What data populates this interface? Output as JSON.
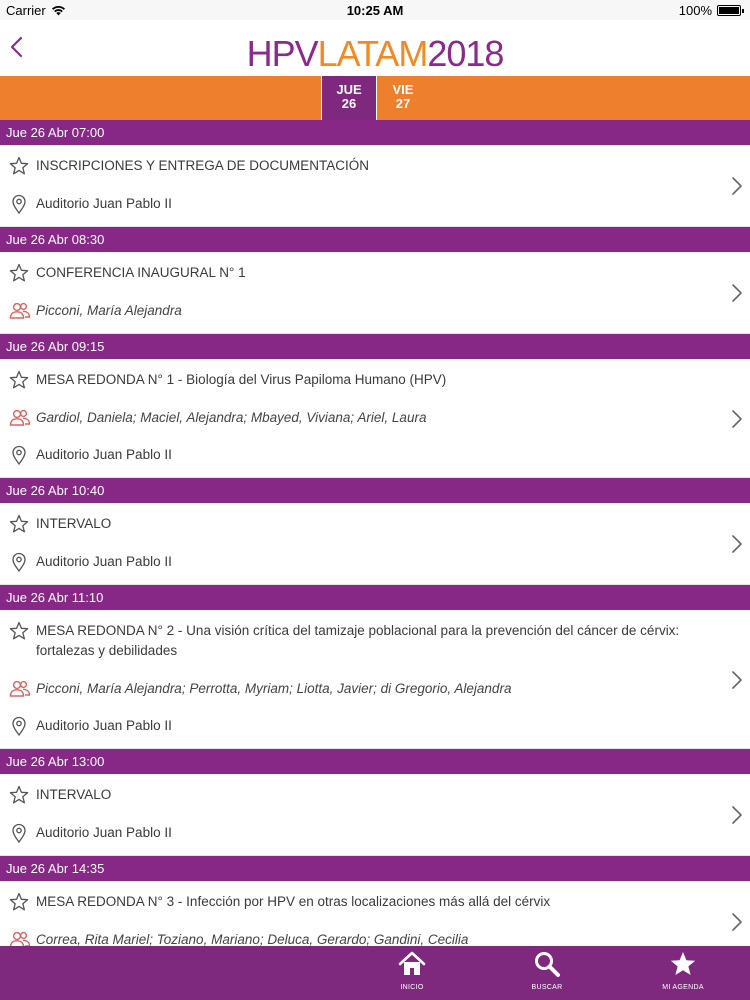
{
  "status": {
    "carrier": "Carrier",
    "time": "10:25 AM",
    "battery": "100%"
  },
  "header": {
    "logo_part1": "HPV",
    "logo_part2": "LATAM",
    "logo_part3": "2018"
  },
  "days": [
    {
      "name": "JUE",
      "num": "26",
      "active": true
    },
    {
      "name": "VIE",
      "num": "27",
      "active": false
    }
  ],
  "sessions": [
    {
      "time": "Jue 26 Abr 07:00",
      "title": "INSCRIPCIONES Y ENTREGA DE DOCUMENTACIÓN",
      "speakers": "",
      "location": "Auditorio Juan Pablo II"
    },
    {
      "time": "Jue 26 Abr 08:30",
      "title": "CONFERENCIA INAUGURAL N° 1",
      "speakers": "Picconi, María Alejandra",
      "location": ""
    },
    {
      "time": "Jue 26 Abr 09:15",
      "title": "MESA REDONDA N° 1 - Biología del Virus Papiloma Humano (HPV)",
      "speakers": "Gardiol, Daniela; Maciel, Alejandra; Mbayed, Viviana; Ariel, Laura",
      "location": "Auditorio Juan Pablo II"
    },
    {
      "time": "Jue 26 Abr 10:40",
      "title": "INTERVALO",
      "speakers": "",
      "location": "Auditorio Juan Pablo II"
    },
    {
      "time": "Jue 26 Abr 11:10",
      "title": "MESA REDONDA N° 2 - Una visión crítica del tamizaje poblacional para la prevención del cáncer de cérvix: fortalezas y debilidades",
      "speakers": "Picconi, María Alejandra; Perrotta, Myriam; Liotta, Javier; di Gregorio, Alejandra",
      "location": "Auditorio Juan Pablo II"
    },
    {
      "time": "Jue 26 Abr 13:00",
      "title": "INTERVALO",
      "speakers": "",
      "location": "Auditorio Juan Pablo II"
    },
    {
      "time": "Jue 26 Abr 14:35",
      "title": "MESA REDONDA N° 3 - Infección por HPV en otras localizaciones más allá del cérvix",
      "speakers": "Correa, Rita Mariel; Toziano, Mariano; Deluca, Gerardo; Gandini, Cecilia",
      "location": ""
    }
  ],
  "tabs": [
    {
      "label": "INICIO",
      "icon": "home-icon"
    },
    {
      "label": "BUSCAR",
      "icon": "search-icon"
    },
    {
      "label": "MI AGENDA",
      "icon": "star-icon"
    }
  ],
  "colors": {
    "purple": "#872886",
    "orange": "#ee7f2d",
    "speaker_icon": "#e06060"
  }
}
